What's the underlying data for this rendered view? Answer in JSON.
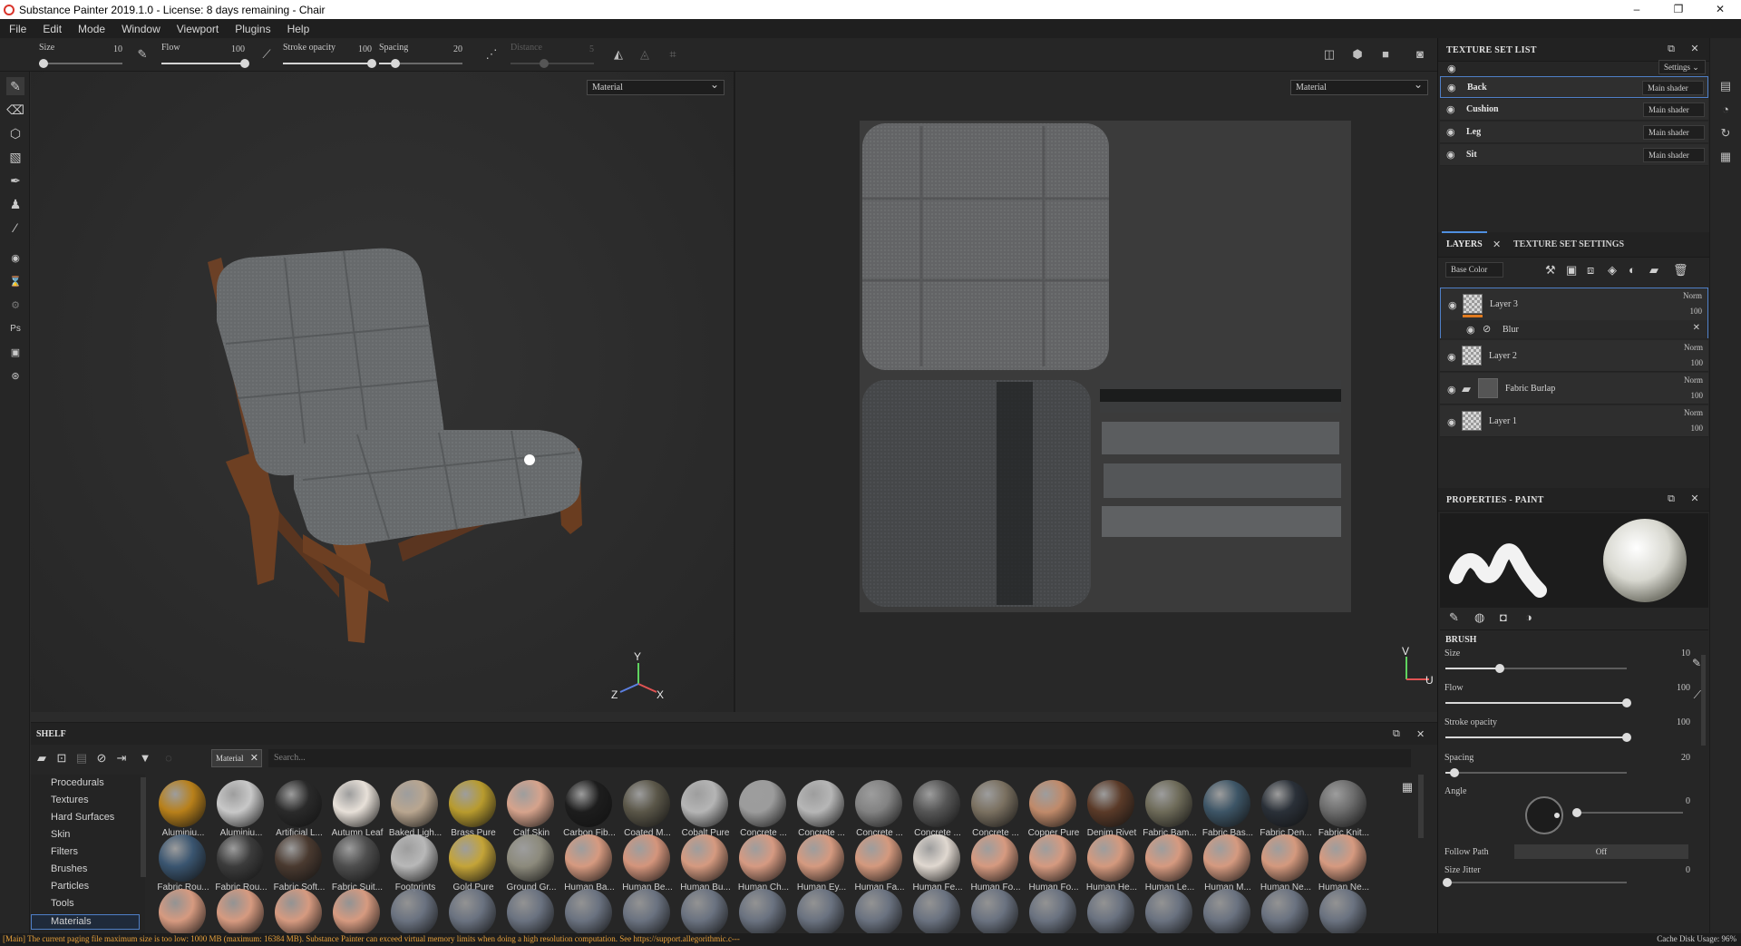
{
  "window": {
    "title": "Substance Painter 2019.1.0 - License: 8 days remaining - Chair",
    "minimize": "–",
    "maximize": "❐",
    "close": "✕"
  },
  "menu": [
    "File",
    "Edit",
    "Mode",
    "Window",
    "Viewport",
    "Plugins",
    "Help"
  ],
  "tool_options": {
    "size": {
      "label": "Size",
      "value": "10",
      "fraction": 0.05
    },
    "flow": {
      "label": "Flow",
      "value": "100",
      "fraction": 1.0
    },
    "stroke_opacity": {
      "label": "Stroke opacity",
      "value": "100",
      "fraction": 1.0
    },
    "spacing": {
      "label": "Spacing",
      "value": "20",
      "fraction": 0.2
    },
    "distance": {
      "label": "Distance",
      "value": "5",
      "fraction": 0.4
    }
  },
  "viewport": {
    "left_mode": "Material",
    "right_mode": "Material",
    "axis_3d": {
      "y": "Y",
      "z": "Z",
      "x": "X"
    },
    "axis_2d": {
      "v": "V",
      "u": "U"
    }
  },
  "texture_set_list": {
    "title": "TEXTURE SET LIST",
    "settings": "Settings ⌄",
    "sets": [
      {
        "name": "Back",
        "shader": "Main shader",
        "selected": true
      },
      {
        "name": "Cushion",
        "shader": "Main shader",
        "selected": false
      },
      {
        "name": "Leg",
        "shader": "Main shader",
        "selected": false
      },
      {
        "name": "Sit",
        "shader": "Main shader",
        "selected": false
      }
    ]
  },
  "layers_panel": {
    "tab_layers": "LAYERS",
    "tab_settings": "TEXTURE SET SETTINGS",
    "channel": "Base Color",
    "layers": [
      {
        "name": "Layer 3",
        "blend": "Norm",
        "opacity": "100"
      },
      {
        "name": "Layer 2",
        "blend": "Norm",
        "opacity": "100"
      },
      {
        "name": "Fabric Burlap",
        "blend": "Norm",
        "opacity": "100"
      },
      {
        "name": "Layer 1",
        "blend": "Norm",
        "opacity": "100"
      }
    ],
    "effect": {
      "name": "Blur"
    }
  },
  "properties": {
    "title": "PROPERTIES - PAINT",
    "section": "BRUSH",
    "size": {
      "label": "Size",
      "value": "10",
      "fraction": 0.3
    },
    "flow": {
      "label": "Flow",
      "value": "100",
      "fraction": 1.0
    },
    "stroke_opacity": {
      "label": "Stroke opacity",
      "value": "100",
      "fraction": 1.0
    },
    "spacing": {
      "label": "Spacing",
      "value": "20",
      "fraction": 0.05
    },
    "angle": {
      "label": "Angle",
      "value": "0"
    },
    "follow_path": {
      "label": "Follow Path",
      "value": "Off"
    },
    "size_jitter": {
      "label": "Size Jitter",
      "value": "0"
    }
  },
  "shelf": {
    "title": "SHELF",
    "filter": "Material",
    "search_placeholder": "Search...",
    "categories": [
      "Procedurals",
      "Textures",
      "Hard Surfaces",
      "Skin",
      "Filters",
      "Brushes",
      "Particles",
      "Tools",
      "Materials"
    ],
    "selected_category": "Materials",
    "row1": [
      {
        "name": "Aluminiu...",
        "color": "#b8801a"
      },
      {
        "name": "Aluminiu...",
        "color": "#c8c8c8"
      },
      {
        "name": "Artificial L...",
        "color": "#2a2a2a"
      },
      {
        "name": "Autumn Leaf",
        "color": "#e7e0d8"
      },
      {
        "name": "Baked Ligh...",
        "color": "#b9a690"
      },
      {
        "name": "Brass Pure",
        "color": "#b89b2e"
      },
      {
        "name": "Calf Skin",
        "color": "#d6a38c"
      },
      {
        "name": "Carbon Fib...",
        "color": "#1d1d1d"
      },
      {
        "name": "Coated M...",
        "color": "#5a5648"
      },
      {
        "name": "Cobalt Pure",
        "color": "#b5b5b5"
      },
      {
        "name": "Concrete ...",
        "color": "#9c9c9c"
      },
      {
        "name": "Concrete ...",
        "color": "#b6b6b6"
      },
      {
        "name": "Concrete ...",
        "color": "#828282"
      },
      {
        "name": "Concrete ...",
        "color": "#555555"
      },
      {
        "name": "Concrete ...",
        "color": "#7a7060"
      },
      {
        "name": "Copper Pure",
        "color": "#c08a6a"
      },
      {
        "name": "Denim Rivet",
        "color": "#5a3a28"
      },
      {
        "name": "Fabric Bam...",
        "color": "#6d6a58"
      },
      {
        "name": "Fabric Bas...",
        "color": "#3d5566"
      },
      {
        "name": "Fabric Den...",
        "color": "#2a3038"
      },
      {
        "name": "Fabric Knit...",
        "color": "#6c6c6c"
      }
    ],
    "row2": [
      {
        "name": "Fabric Rou...",
        "color": "#3a5570"
      },
      {
        "name": "Fabric Rou...",
        "color": "#3c3c3c"
      },
      {
        "name": "Fabric Soft...",
        "color": "#4a3a30"
      },
      {
        "name": "Fabric Suit...",
        "color": "#4e4e4e"
      },
      {
        "name": "Footprints",
        "color": "#b8b8b8"
      },
      {
        "name": "Gold Pure",
        "color": "#c4a438"
      },
      {
        "name": "Ground Gr...",
        "color": "#8c8a7c"
      },
      {
        "name": "Human Ba...",
        "color": "#d69a80"
      },
      {
        "name": "Human Be...",
        "color": "#d4957c"
      },
      {
        "name": "Human Bu...",
        "color": "#d59a80"
      },
      {
        "name": "Human Ch...",
        "color": "#d69a82"
      },
      {
        "name": "Human Ey...",
        "color": "#d59a80"
      },
      {
        "name": "Human Fa...",
        "color": "#d4997e"
      },
      {
        "name": "Human Fe...",
        "color": "#e0d8d0"
      },
      {
        "name": "Human Fo...",
        "color": "#d69a80"
      },
      {
        "name": "Human Fo...",
        "color": "#d59a80"
      },
      {
        "name": "Human He...",
        "color": "#d4997e"
      },
      {
        "name": "Human Le...",
        "color": "#d69a80"
      },
      {
        "name": "Human M...",
        "color": "#d59a80"
      },
      {
        "name": "Human Ne...",
        "color": "#d4997e"
      },
      {
        "name": "Human Ne...",
        "color": "#d69a80"
      }
    ]
  },
  "status": {
    "message": "[Main] The current paging file maximum size is too low: 1000 MB (maximum: 16384 MB). Substance Painter can exceed virtual memory limits when doing a high resolution computation. See https://support.allegorithmic.c---",
    "cache": "Cache Disk Usage:   96%"
  }
}
